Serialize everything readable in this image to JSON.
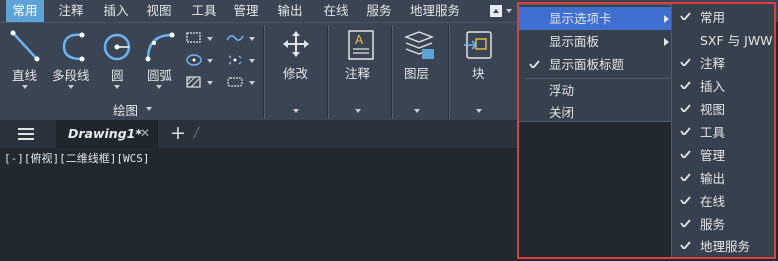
{
  "menu_tabs": [
    "常用",
    "注释",
    "插入",
    "视图",
    "工具",
    "管理",
    "输出",
    "在线",
    "服务",
    "地理服务"
  ],
  "active_tab": "常用",
  "ribbon": {
    "draw_tools": [
      "直线",
      "多段线",
      "圆",
      "圆弧"
    ],
    "draw_panel_label": "绘图",
    "modify_label": "修改",
    "annotate_label": "注释",
    "layers_label": "图层",
    "block_label": "块"
  },
  "document_tab": {
    "title": "Drawing1*",
    "close": "✕",
    "add": "+",
    "slash": "/"
  },
  "viewport_label": "[-][俯视][二维线框][WCS]",
  "context_menu": {
    "items": [
      {
        "label": "显示选项卡",
        "submenu": true,
        "checked": false,
        "highlighted": true
      },
      {
        "label": "显示面板",
        "submenu": true,
        "checked": false,
        "highlighted": false
      },
      {
        "label": "显示面板标题",
        "submenu": false,
        "checked": true,
        "highlighted": false
      },
      {
        "label": "浮动",
        "submenu": false,
        "checked": false,
        "highlighted": false
      },
      {
        "label": "关闭",
        "submenu": false,
        "checked": false,
        "highlighted": false
      }
    ]
  },
  "submenu": {
    "items": [
      {
        "label": "常用",
        "checked": true
      },
      {
        "label": "SXF 与 JWW",
        "checked": false
      },
      {
        "label": "注释",
        "checked": true
      },
      {
        "label": "插入",
        "checked": true
      },
      {
        "label": "视图",
        "checked": true
      },
      {
        "label": "工具",
        "checked": true
      },
      {
        "label": "管理",
        "checked": true
      },
      {
        "label": "输出",
        "checked": true
      },
      {
        "label": "在线",
        "checked": true
      },
      {
        "label": "服务",
        "checked": true
      },
      {
        "label": "地理服务",
        "checked": true
      }
    ]
  },
  "colors": {
    "accent": "#5da3d8",
    "highlight": "#3f6fd0",
    "annotation_border": "#e03c3c"
  }
}
